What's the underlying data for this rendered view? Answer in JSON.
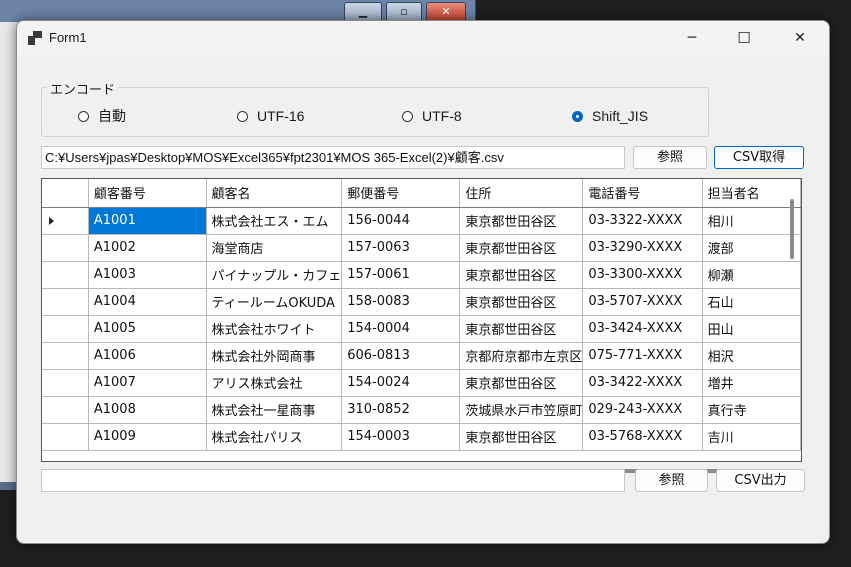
{
  "window": {
    "title": "Form1",
    "minimize": "─",
    "maximize": "☐",
    "close": "✕"
  },
  "background_window": {
    "min": "▁",
    "max": "▫",
    "close": "✕"
  },
  "encoding": {
    "legend": "エンコード",
    "options": [
      {
        "label": "自動",
        "checked": false
      },
      {
        "label": "UTF-16",
        "checked": false
      },
      {
        "label": "UTF-8",
        "checked": false
      },
      {
        "label": "Shift_JIS",
        "checked": true
      }
    ]
  },
  "input_row": {
    "path_value": "C:¥Users¥jpas¥Desktop¥MOS¥Excel365¥fpt2301¥MOS 365-Excel(2)¥顧客.csv",
    "browse_label": "参照",
    "load_label": "CSV取得"
  },
  "grid": {
    "columns": [
      "顧客番号",
      "顧客名",
      "郵便番号",
      "住所",
      "電話番号",
      "担当者名"
    ],
    "rows": [
      [
        "A1001",
        "株式会社エス・エム",
        "156-0044",
        "東京都世田谷区",
        "03-3322-XXXX",
        "相川"
      ],
      [
        "A1002",
        "海堂商店",
        "157-0063",
        "東京都世田谷区",
        "03-3290-XXXX",
        "渡部"
      ],
      [
        "A1003",
        "パイナップル・カフェ",
        "157-0061",
        "東京都世田谷区",
        "03-3300-XXXX",
        "柳瀬"
      ],
      [
        "A1004",
        "ティールームOKUDA",
        "158-0083",
        "東京都世田谷区",
        "03-5707-XXXX",
        "石山"
      ],
      [
        "A1005",
        "株式会社ホワイト",
        "154-0004",
        "東京都世田谷区",
        "03-3424-XXXX",
        "田山"
      ],
      [
        "A1006",
        "株式会社外岡商事",
        "606-0813",
        "京都府京都市左京区",
        "075-771-XXXX",
        "相沢"
      ],
      [
        "A1007",
        "アリス株式会社",
        "154-0024",
        "東京都世田谷区",
        "03-3422-XXXX",
        "増井"
      ],
      [
        "A1008",
        "株式会社一星商事",
        "310-0852",
        "茨城県水戸市笠原町",
        "029-243-XXXX",
        "真行寺"
      ],
      [
        "A1009",
        "株式会社パリス",
        "154-0003",
        "東京都世田谷区",
        "03-5768-XXXX",
        "吉川"
      ]
    ],
    "selected_row": 0
  },
  "output_row": {
    "path_value": "",
    "browse_label": "参照",
    "export_label": "CSV出力"
  },
  "colors": {
    "accent": "#0078d7",
    "radio_checked": "#0067c0"
  }
}
